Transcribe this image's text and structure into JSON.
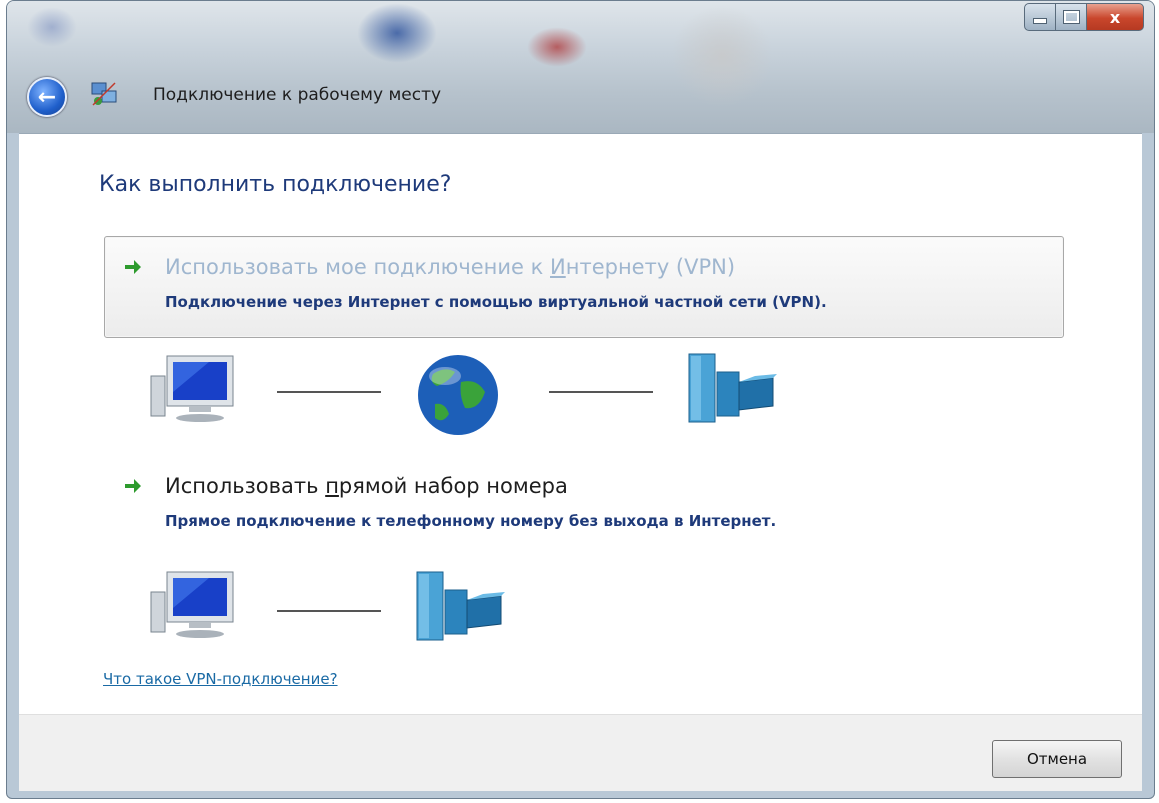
{
  "window": {
    "title": "Подключение к рабочему месту",
    "controls": {
      "minimize": "",
      "maximize": "",
      "close": "x"
    }
  },
  "heading": "Как выполнить подключение?",
  "options": [
    {
      "title_before": "Использовать мое подключение к ",
      "title_underlined": "И",
      "title_after": "нтернету (VPN)",
      "description": "Подключение через Интернет с помощью виртуальной частной сети (VPN).",
      "diagram_icons": [
        "computer-icon",
        "globe-icon",
        "workplace-network-icon"
      ]
    },
    {
      "title_before": "Использовать ",
      "title_underlined": "п",
      "title_after": "рямой набор номера",
      "description": "Прямое подключение к телефонному номеру без выхода в Интернет.",
      "diagram_icons": [
        "computer-icon",
        "workplace-network-icon"
      ]
    }
  ],
  "help_link": "Что такое VPN-подключение?",
  "footer": {
    "cancel_label": "Отмена"
  },
  "colors": {
    "heading": "#1e3a7a",
    "option1_title": "#9fb6cf",
    "option_desc": "#1e3a7a",
    "link": "#1a6aa5",
    "arrow": "#2e9b2e"
  }
}
